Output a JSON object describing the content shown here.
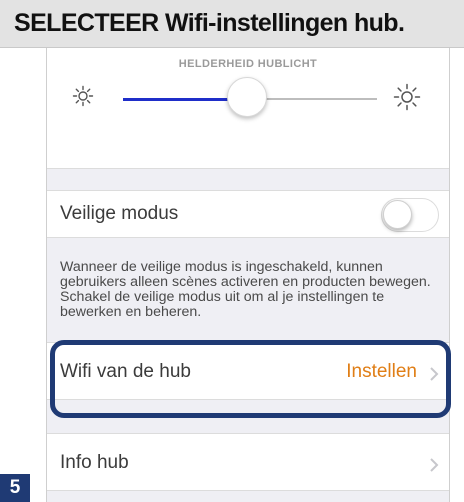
{
  "header": {
    "title": "SELECTEER Wifi-instellingen hub."
  },
  "brightness": {
    "label": "HELDERHEID HUBLICHT",
    "level_percent": 49,
    "icons": [
      "sun-small-icon",
      "sun-large-icon"
    ],
    "fill_color": "#1f2ec9"
  },
  "safe_mode": {
    "label": "Veilige modus",
    "toggle_on": false,
    "description": "Wanneer de veilige modus is ingeschakeld, kunnen gebruikers alleen scènes activeren en producten bewegen. Schakel de veilige modus uit om al je instellingen te bewerken en beheren."
  },
  "wifi": {
    "label": "Wifi van de hub",
    "action": "Instellen",
    "action_color": "#e07e16"
  },
  "info": {
    "label": "Info hub"
  },
  "highlight_color": "#1f3a74",
  "step": {
    "number": "5"
  }
}
